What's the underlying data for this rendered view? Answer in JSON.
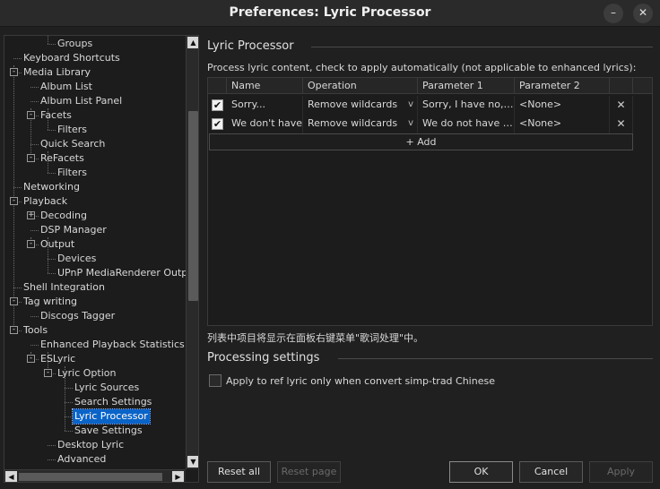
{
  "window": {
    "title": "Preferences: Lyric Processor",
    "min_icon": "minimize-icon",
    "close_icon": "close-icon"
  },
  "tree": {
    "items": [
      {
        "label": "Groups",
        "selected": false
      },
      {
        "label": "Keyboard Shortcuts",
        "selected": false
      },
      {
        "label": "Media Library",
        "selected": false
      },
      {
        "label": "Album List",
        "selected": false
      },
      {
        "label": "Album List Panel",
        "selected": false
      },
      {
        "label": "Facets",
        "selected": false
      },
      {
        "label": "Filters",
        "selected": false
      },
      {
        "label": "Quick Search",
        "selected": false
      },
      {
        "label": "ReFacets",
        "selected": false
      },
      {
        "label": "Filters",
        "selected": false
      },
      {
        "label": "Networking",
        "selected": false
      },
      {
        "label": "Playback",
        "selected": false
      },
      {
        "label": "Decoding",
        "selected": false
      },
      {
        "label": "DSP Manager",
        "selected": false
      },
      {
        "label": "Output",
        "selected": false
      },
      {
        "label": "Devices",
        "selected": false
      },
      {
        "label": "UPnP MediaRenderer Output",
        "selected": false
      },
      {
        "label": "Shell Integration",
        "selected": false
      },
      {
        "label": "Tag writing",
        "selected": false
      },
      {
        "label": "Discogs Tagger",
        "selected": false
      },
      {
        "label": "Tools",
        "selected": false
      },
      {
        "label": "Enhanced Playback Statistics",
        "selected": false
      },
      {
        "label": "ESLyric",
        "selected": false
      },
      {
        "label": "Lyric Option",
        "selected": false
      },
      {
        "label": "Lyric Sources",
        "selected": false
      },
      {
        "label": "Search Settings",
        "selected": false
      },
      {
        "label": "Lyric Processor",
        "selected": true
      },
      {
        "label": "Save Settings",
        "selected": false
      },
      {
        "label": "Desktop Lyric",
        "selected": false
      },
      {
        "label": "Advanced",
        "selected": false
      }
    ]
  },
  "lyric_processor": {
    "group_title": "Lyric Processor",
    "description": "Process lyric content, check to apply automatically (not applicable to enhanced lyrics):",
    "columns": [
      "Name",
      "Operation",
      "Parameter 1",
      "Parameter 2"
    ],
    "rows": [
      {
        "checked": true,
        "name": "Sorry...",
        "operation": "Remove wildcards",
        "param1": "Sorry, I have no, w...",
        "param2": "<None>"
      },
      {
        "checked": true,
        "name": "We don't have",
        "operation": "Remove wildcards",
        "param1": "We do not have th...",
        "param2": "<None>"
      }
    ],
    "add_label": "+ Add",
    "note": "列表中项目将显示在面板右键菜单\"歌词处理\"中。"
  },
  "processing": {
    "group_title": "Processing settings",
    "checkbox_label": "Apply to ref lyric only when convert simp-trad Chinese",
    "checked": false
  },
  "buttons": {
    "reset_all": "Reset all",
    "reset_page": "Reset page",
    "ok": "OK",
    "cancel": "Cancel",
    "apply": "Apply"
  }
}
